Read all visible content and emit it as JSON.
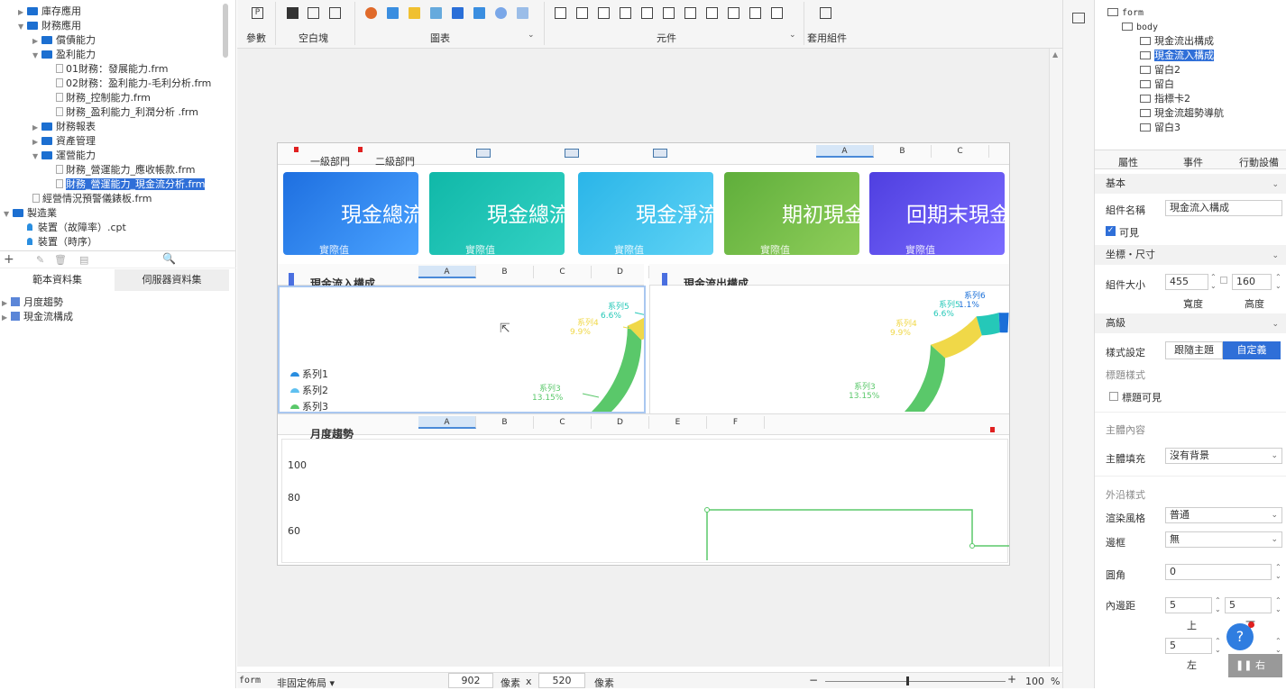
{
  "tree": {
    "items": [
      {
        "label": "庫存應用",
        "level": 1,
        "type": "folder",
        "expanded": false
      },
      {
        "label": "財務應用",
        "level": 1,
        "type": "folder",
        "expanded": true
      },
      {
        "label": "償債能力",
        "level": 2,
        "type": "folder",
        "expanded": false
      },
      {
        "label": "盈利能力",
        "level": 2,
        "type": "folder",
        "expanded": true
      },
      {
        "label": "01財務：發展能力.frm",
        "level": 3,
        "type": "file"
      },
      {
        "label": "02財務：盈利能力-毛利分析.frm",
        "level": 3,
        "type": "file"
      },
      {
        "label": "財務_控制能力.frm",
        "level": 3,
        "type": "file"
      },
      {
        "label": "財務_盈利能力_利潤分析 .frm",
        "level": 3,
        "type": "file"
      },
      {
        "label": "財務報表",
        "level": 2,
        "type": "folder",
        "expanded": false
      },
      {
        "label": "資產管理",
        "level": 2,
        "type": "folder",
        "expanded": false
      },
      {
        "label": "運營能力",
        "level": 2,
        "type": "folder",
        "expanded": true
      },
      {
        "label": "財務_營運能力_應收帳款.frm",
        "level": 3,
        "type": "file"
      },
      {
        "label": "財務_營運能力_現金流分析.frm",
        "level": 3,
        "type": "file",
        "selected": true
      },
      {
        "label": "經營情況預警儀錶板.frm",
        "level": 2,
        "type": "file"
      },
      {
        "label": "製造業",
        "level": 0,
        "type": "folder",
        "expanded": true
      },
      {
        "label": "裝置（故障率）.cpt",
        "level": 1,
        "type": "cpt"
      },
      {
        "label": "裝置（時序）",
        "level": 1,
        "type": "cpt"
      }
    ]
  },
  "dataset_tabs": {
    "template": "範本資料集",
    "server": "伺服器資料集"
  },
  "datasets": [
    "月度趨勢",
    "現金流構成"
  ],
  "toolbar": {
    "param": "參數",
    "blank": "空白塊",
    "chart": "圖表",
    "widget": "元件",
    "apply": "套用組件"
  },
  "sheet_cols1": [
    "A",
    "B",
    "C"
  ],
  "sheet_cols2": [
    "A",
    "B",
    "C",
    "D"
  ],
  "sheet_cols3": [
    "A",
    "B",
    "C",
    "D",
    "E",
    "F"
  ],
  "canvas": {
    "truncated_labels": [
      "一級部門",
      "二級部門"
    ],
    "cards": [
      {
        "title": "現金總流",
        "sub": "實際值",
        "c1": "#1e6fe0",
        "c2": "#4aa3ff"
      },
      {
        "title": "現金總流",
        "sub": "實際值",
        "c1": "#10b8a8",
        "c2": "#33d1c4"
      },
      {
        "title": "現金淨流",
        "sub": "實際值",
        "c1": "#2ab5e8",
        "c2": "#5fd3f5"
      },
      {
        "title": "期初現金",
        "sub": "實際值",
        "c1": "#5fae3b",
        "c2": "#8fce5a"
      },
      {
        "title": "回期末現金",
        "sub": "實際值",
        "c1": "#4f3fe0",
        "c2": "#7b6cff"
      }
    ],
    "panel_left_title": "現金流入構成",
    "panel_right_title": "現金流出構成",
    "trend_title": "月度趨勢",
    "trend_y_ticks": [
      "100",
      "80",
      "60"
    ]
  },
  "chart_data": [
    {
      "type": "pie",
      "title": "",
      "series": [
        {
          "name": "系列1",
          "label": "",
          "color": "#2a8ee0"
        },
        {
          "name": "系列2",
          "label": "",
          "color": "#5fc0f0"
        },
        {
          "name": "系列3",
          "label": "13.15%",
          "color": "#5ac86a"
        },
        {
          "name": "系列4",
          "label": "9.9%",
          "color": "#f0d848"
        },
        {
          "name": "系列5",
          "label": "6.6%",
          "color": "#25c8b8"
        }
      ],
      "legend": [
        "系列1",
        "系列2",
        "系列3"
      ]
    },
    {
      "type": "pie",
      "title": "",
      "series": [
        {
          "name": "系列3",
          "label": "13.15%",
          "color": "#5ac86a"
        },
        {
          "name": "系列4",
          "label": "9.9%",
          "color": "#f0d848"
        },
        {
          "name": "系列5",
          "label": "6.6%",
          "color": "#25c8b8"
        },
        {
          "name": "系列6",
          "label": "1.1%",
          "color": "#1a6fd8"
        }
      ]
    },
    {
      "type": "line",
      "title": "月度趨勢",
      "y_ticks": [
        100,
        80,
        60
      ],
      "color": "#5ac86a"
    }
  ],
  "status": {
    "form": "form",
    "layout": "非固定佈局",
    "width": "902",
    "px1": "像素",
    "x": "x",
    "height": "520",
    "px2": "像素",
    "zoom": "100",
    "pct": "%"
  },
  "right": {
    "tree": [
      "form",
      "body",
      "現金流出構成",
      "現金流入構成",
      "留白2",
      "留白",
      "指標卡2",
      "現金流趨勢導航",
      "留白3"
    ],
    "tabs": [
      "屬性",
      "事件",
      "行動設備"
    ],
    "basic": "基本",
    "name_label": "組件名稱",
    "name_value": "現金流入構成",
    "visible": "可見",
    "coord": "坐標・尺寸",
    "size_label": "組件大小",
    "w_val": "455",
    "h_val": "160",
    "w_label": "寬度",
    "h_label": "高度",
    "advanced": "高級",
    "style_label": "樣式設定",
    "follow": "跟隨主題",
    "custom": "自定義",
    "title_style": "標題樣式",
    "title_visible": "標題可見",
    "content": "主體內容",
    "fill_label": "主體填充",
    "fill_value": "沒有背景",
    "border_style": "外沿樣式",
    "render_label": "渲染風格",
    "render_value": "普通",
    "border_label": "邊框",
    "border_value": "無",
    "radius_label": "圓角",
    "radius_value": "0",
    "padding_label": "內邊距",
    "pad_top": "5",
    "pad_bottom": "5",
    "pad_left": "5",
    "top": "上",
    "bottom": "下",
    "left": "左",
    "right": "右",
    "help": "?"
  }
}
